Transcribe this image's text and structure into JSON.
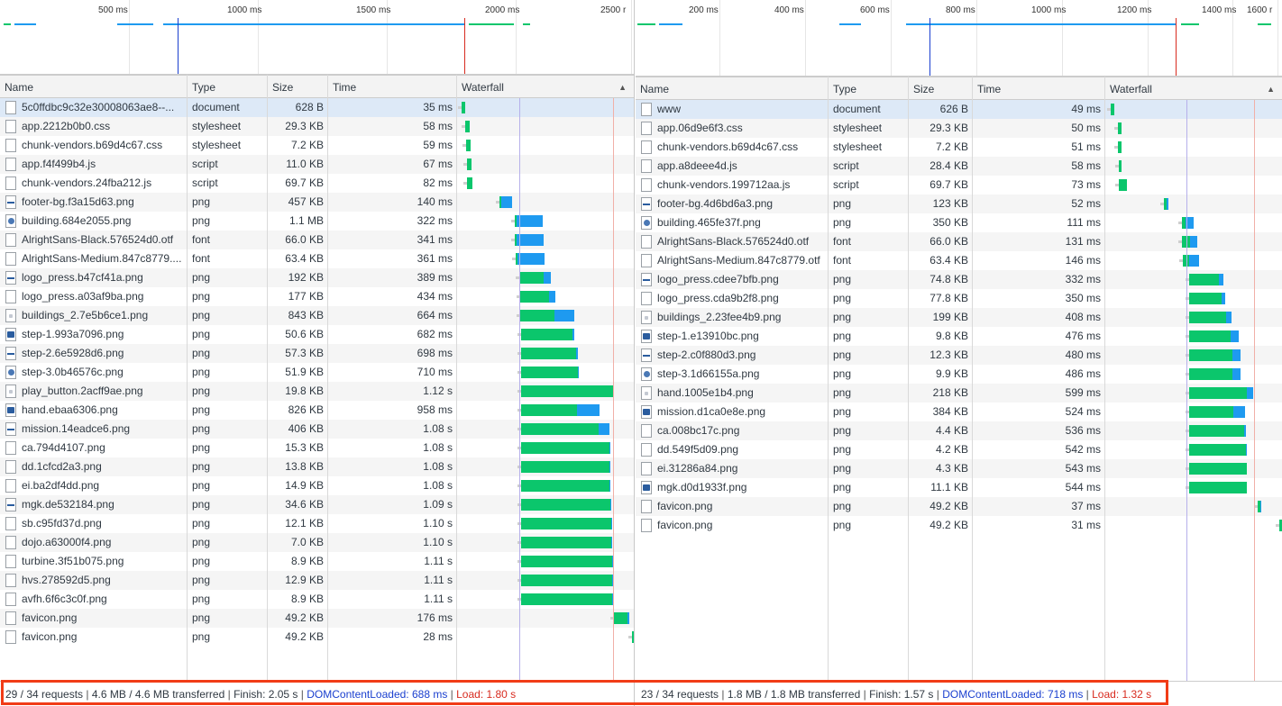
{
  "left": {
    "overview_ticks": [
      "500 ms",
      "1000 ms",
      "1500 ms",
      "2000 ms",
      "2500 r"
    ],
    "columns": {
      "name": "Name",
      "type": "Type",
      "size": "Size",
      "time": "Time",
      "waterfall": "Waterfall"
    },
    "sort_indicator": "▲",
    "rows": [
      {
        "name": "5c0ffdbc9c32e30008063ae8--...",
        "type": "document",
        "size": "628 B",
        "time": "35 ms",
        "icon": "document-icon"
      },
      {
        "name": "app.2212b0b0.css",
        "type": "stylesheet",
        "size": "29.3 KB",
        "time": "58 ms",
        "icon": "file-icon"
      },
      {
        "name": "chunk-vendors.b69d4c67.css",
        "type": "stylesheet",
        "size": "7.2 KB",
        "time": "59 ms",
        "icon": "file-icon"
      },
      {
        "name": "app.f4f499b4.js",
        "type": "script",
        "size": "11.0 KB",
        "time": "67 ms",
        "icon": "file-icon"
      },
      {
        "name": "chunk-vendors.24fba212.js",
        "type": "script",
        "size": "69.7 KB",
        "time": "82 ms",
        "icon": "file-icon"
      },
      {
        "name": "footer-bg.f3a15d63.png",
        "type": "png",
        "size": "457 KB",
        "time": "140 ms",
        "icon": "image-thumbnail-icon"
      },
      {
        "name": "building.684e2055.png",
        "type": "png",
        "size": "1.1 MB",
        "time": "322 ms",
        "icon": "image-thumbnail-icon"
      },
      {
        "name": "AlrightSans-Black.576524d0.otf",
        "type": "font",
        "size": "66.0 KB",
        "time": "341 ms",
        "icon": "file-icon"
      },
      {
        "name": "AlrightSans-Medium.847c8779....",
        "type": "font",
        "size": "63.4 KB",
        "time": "361 ms",
        "icon": "file-icon"
      },
      {
        "name": "logo_press.b47cf41a.png",
        "type": "png",
        "size": "192 KB",
        "time": "389 ms",
        "icon": "image-thumbnail-icon"
      },
      {
        "name": "logo_press.a03af9ba.png",
        "type": "png",
        "size": "177 KB",
        "time": "434 ms",
        "icon": "file-icon"
      },
      {
        "name": "buildings_2.7e5b6ce1.png",
        "type": "png",
        "size": "843 KB",
        "time": "664 ms",
        "icon": "image-thumbnail-icon"
      },
      {
        "name": "step-1.993a7096.png",
        "type": "png",
        "size": "50.6 KB",
        "time": "682 ms",
        "icon": "image-thumbnail-icon"
      },
      {
        "name": "step-2.6e5928d6.png",
        "type": "png",
        "size": "57.3 KB",
        "time": "698 ms",
        "icon": "image-thumbnail-icon"
      },
      {
        "name": "step-3.0b46576c.png",
        "type": "png",
        "size": "51.9 KB",
        "time": "710 ms",
        "icon": "image-thumbnail-icon"
      },
      {
        "name": "play_button.2acff9ae.png",
        "type": "png",
        "size": "19.8 KB",
        "time": "1.12 s",
        "icon": "image-thumbnail-icon"
      },
      {
        "name": "hand.ebaa6306.png",
        "type": "png",
        "size": "826 KB",
        "time": "958 ms",
        "icon": "image-thumbnail-icon"
      },
      {
        "name": "mission.14eadce6.png",
        "type": "png",
        "size": "406 KB",
        "time": "1.08 s",
        "icon": "image-thumbnail-icon"
      },
      {
        "name": "ca.794d4107.png",
        "type": "png",
        "size": "15.3 KB",
        "time": "1.08 s",
        "icon": "file-icon"
      },
      {
        "name": "dd.1cfcd2a3.png",
        "type": "png",
        "size": "13.8 KB",
        "time": "1.08 s",
        "icon": "file-icon"
      },
      {
        "name": "ei.ba2df4dd.png",
        "type": "png",
        "size": "14.9 KB",
        "time": "1.08 s",
        "icon": "file-icon"
      },
      {
        "name": "mgk.de532184.png",
        "type": "png",
        "size": "34.6 KB",
        "time": "1.09 s",
        "icon": "image-thumbnail-icon"
      },
      {
        "name": "sb.c95fd37d.png",
        "type": "png",
        "size": "12.1 KB",
        "time": "1.10 s",
        "icon": "file-icon"
      },
      {
        "name": "dojo.a63000f4.png",
        "type": "png",
        "size": "7.0 KB",
        "time": "1.10 s",
        "icon": "file-icon"
      },
      {
        "name": "turbine.3f51b075.png",
        "type": "png",
        "size": "8.9 KB",
        "time": "1.11 s",
        "icon": "file-icon"
      },
      {
        "name": "hvs.278592d5.png",
        "type": "png",
        "size": "12.9 KB",
        "time": "1.11 s",
        "icon": "file-icon"
      },
      {
        "name": "avfh.6f6c3c0f.png",
        "type": "png",
        "size": "8.9 KB",
        "time": "1.11 s",
        "icon": "file-icon"
      },
      {
        "name": "favicon.png",
        "type": "png",
        "size": "49.2 KB",
        "time": "176 ms",
        "icon": "file-icon"
      },
      {
        "name": "favicon.png",
        "type": "png",
        "size": "49.2 KB",
        "time": "28 ms",
        "icon": "file-icon"
      }
    ],
    "status": {
      "requests": "29 / 34 requests",
      "transferred": "4.6 MB / 4.6 MB transferred",
      "finish": "Finish: 2.05 s",
      "dom_content_loaded": "DOMContentLoaded: 688 ms",
      "load": "Load: 1.80 s"
    }
  },
  "right": {
    "overview_ticks": [
      "200 ms",
      "400 ms",
      "600 ms",
      "800 ms",
      "1000 ms",
      "1200 ms",
      "1400 ms",
      "1600 r"
    ],
    "columns": {
      "name": "Name",
      "type": "Type",
      "size": "Size",
      "time": "Time",
      "waterfall": "Waterfall"
    },
    "sort_indicator": "▲",
    "rows": [
      {
        "name": "www",
        "type": "document",
        "size": "626 B",
        "time": "49 ms",
        "icon": "document-icon"
      },
      {
        "name": "app.06d9e6f3.css",
        "type": "stylesheet",
        "size": "29.3 KB",
        "time": "50 ms",
        "icon": "file-icon"
      },
      {
        "name": "chunk-vendors.b69d4c67.css",
        "type": "stylesheet",
        "size": "7.2 KB",
        "time": "51 ms",
        "icon": "file-icon"
      },
      {
        "name": "app.a8deee4d.js",
        "type": "script",
        "size": "28.4 KB",
        "time": "58 ms",
        "icon": "file-icon"
      },
      {
        "name": "chunk-vendors.199712aa.js",
        "type": "script",
        "size": "69.7 KB",
        "time": "73 ms",
        "icon": "file-icon"
      },
      {
        "name": "footer-bg.4d6bd6a3.png",
        "type": "png",
        "size": "123 KB",
        "time": "52 ms",
        "icon": "image-thumbnail-icon"
      },
      {
        "name": "building.465fe37f.png",
        "type": "png",
        "size": "350 KB",
        "time": "111 ms",
        "icon": "image-thumbnail-icon"
      },
      {
        "name": "AlrightSans-Black.576524d0.otf",
        "type": "font",
        "size": "66.0 KB",
        "time": "131 ms",
        "icon": "file-icon"
      },
      {
        "name": "AlrightSans-Medium.847c8779.otf",
        "type": "font",
        "size": "63.4 KB",
        "time": "146 ms",
        "icon": "file-icon"
      },
      {
        "name": "logo_press.cdee7bfb.png",
        "type": "png",
        "size": "74.8 KB",
        "time": "332 ms",
        "icon": "image-thumbnail-icon"
      },
      {
        "name": "logo_press.cda9b2f8.png",
        "type": "png",
        "size": "77.8 KB",
        "time": "350 ms",
        "icon": "file-icon"
      },
      {
        "name": "buildings_2.23fee4b9.png",
        "type": "png",
        "size": "199 KB",
        "time": "408 ms",
        "icon": "image-thumbnail-icon"
      },
      {
        "name": "step-1.e13910bc.png",
        "type": "png",
        "size": "9.8 KB",
        "time": "476 ms",
        "icon": "image-thumbnail-icon"
      },
      {
        "name": "step-2.c0f880d3.png",
        "type": "png",
        "size": "12.3 KB",
        "time": "480 ms",
        "icon": "image-thumbnail-icon"
      },
      {
        "name": "step-3.1d66155a.png",
        "type": "png",
        "size": "9.9 KB",
        "time": "486 ms",
        "icon": "image-thumbnail-icon"
      },
      {
        "name": "hand.1005e1b4.png",
        "type": "png",
        "size": "218 KB",
        "time": "599 ms",
        "icon": "image-thumbnail-icon"
      },
      {
        "name": "mission.d1ca0e8e.png",
        "type": "png",
        "size": "384 KB",
        "time": "524 ms",
        "icon": "image-thumbnail-icon"
      },
      {
        "name": "ca.008bc17c.png",
        "type": "png",
        "size": "4.4 KB",
        "time": "536 ms",
        "icon": "file-icon"
      },
      {
        "name": "dd.549f5d09.png",
        "type": "png",
        "size": "4.2 KB",
        "time": "542 ms",
        "icon": "file-icon"
      },
      {
        "name": "ei.31286a84.png",
        "type": "png",
        "size": "4.3 KB",
        "time": "543 ms",
        "icon": "file-icon"
      },
      {
        "name": "mgk.d0d1933f.png",
        "type": "png",
        "size": "11.1 KB",
        "time": "544 ms",
        "icon": "image-thumbnail-icon"
      },
      {
        "name": "favicon.png",
        "type": "png",
        "size": "49.2 KB",
        "time": "37 ms",
        "icon": "file-icon"
      },
      {
        "name": "favicon.png",
        "type": "png",
        "size": "49.2 KB",
        "time": "31 ms",
        "icon": "file-icon"
      }
    ],
    "status": {
      "requests": "23 / 34 requests",
      "transferred": "1.8 MB / 1.8 MB transferred",
      "finish": "Finish: 1.57 s",
      "dom_content_loaded": "DOMContentLoaded: 718 ms",
      "load": "Load: 1.32 s"
    }
  },
  "colors": {
    "waiting": "#0bc66c",
    "download": "#1e9af0",
    "dom_line": "#1a3fcf",
    "load_line": "#d82b1f",
    "highlight_box": "#f13c17"
  }
}
